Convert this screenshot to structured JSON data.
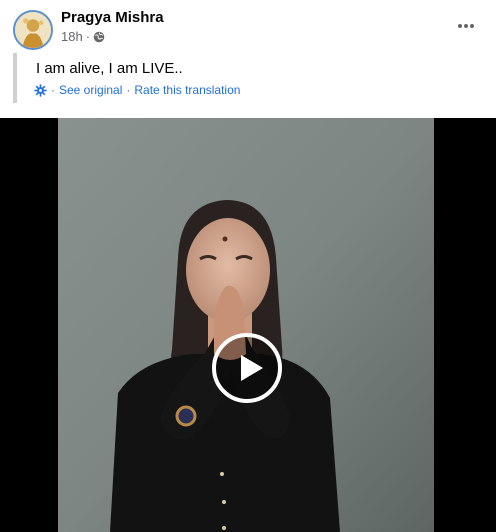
{
  "post": {
    "author": "Pragya Mishra",
    "time": "18h",
    "separator": "·",
    "text": "I am alive, I am LIVE..",
    "privacy_icon": "globe-icon",
    "more_icon": "more-options-icon"
  },
  "translation": {
    "see_original": "See original",
    "separator": "·",
    "rate": "Rate this translation",
    "icon": "gear-icon"
  },
  "video": {
    "play_icon": "play-icon"
  },
  "colors": {
    "link": "#216fdb",
    "meta": "#65676b",
    "video_bg": "#000000",
    "wall": "#7b8483"
  }
}
